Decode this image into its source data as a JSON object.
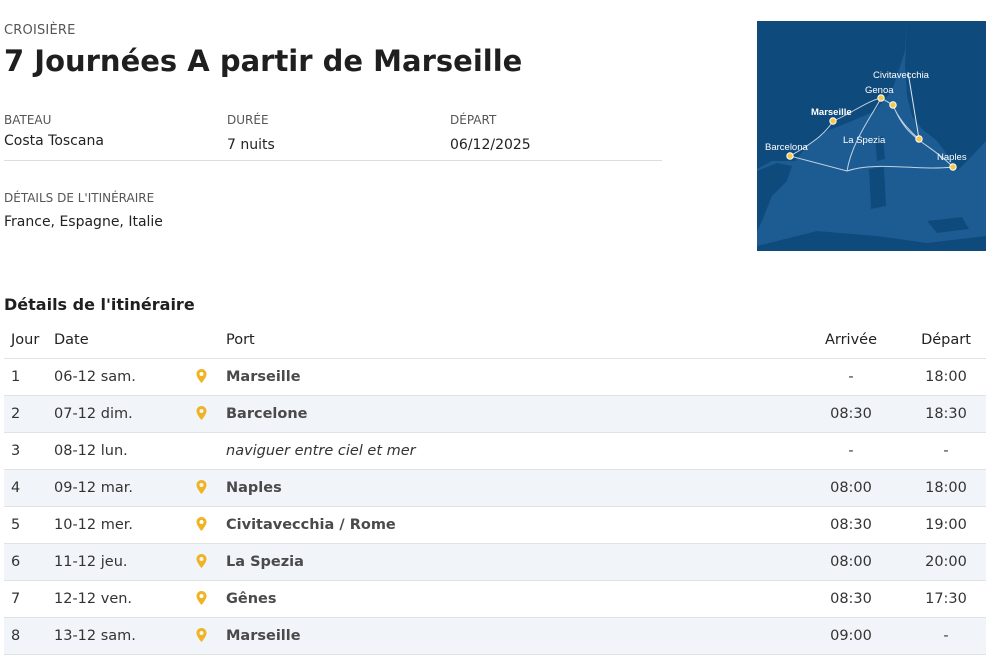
{
  "header": {
    "eyebrow": "CROISIÈRE",
    "title": "7 Journées A partir de Marseille"
  },
  "meta": {
    "ship_label": "BATEAU",
    "ship_value": "Costa Toscana",
    "duration_label": "DURÉE",
    "duration_value": "7 nuits",
    "departure_label": "DÉPART",
    "departure_value": "06/12/2025",
    "itinerary_label": "DÉTAILS DE L'ITINÉRAIRE",
    "itinerary_value": "France, Espagne, Italie"
  },
  "map": {
    "labels": {
      "civitavecchia": "Civitavecchia",
      "genoa": "Genoa",
      "marseille": "Marseille",
      "la_spezia": "La Spezia",
      "barcelona": "Barcelona",
      "naples": "Naples"
    },
    "colors": {
      "sea": "#1d5c93",
      "land": "#0f4a7d",
      "route": "#dbe7f2",
      "dot": "#f2c94c"
    }
  },
  "section": {
    "title": "Détails de l'itinéraire"
  },
  "table": {
    "headers": {
      "day": "Jour",
      "date": "Date",
      "port": "Port",
      "arrival": "Arrivée",
      "departure": "Départ"
    },
    "rows": [
      {
        "day": "1",
        "date": "06-12 sam.",
        "port": "Marseille",
        "arrival": "-",
        "departure": "18:00"
      },
      {
        "day": "2",
        "date": "07-12 dim.",
        "port": "Barcelone",
        "arrival": "08:30",
        "departure": "18:30"
      },
      {
        "day": "3",
        "date": "08-12 lun.",
        "port": "naviguer entre ciel et mer",
        "arrival": "-",
        "departure": "-"
      },
      {
        "day": "4",
        "date": "09-12 mar.",
        "port": "Naples",
        "arrival": "08:00",
        "departure": "18:00"
      },
      {
        "day": "5",
        "date": "10-12 mer.",
        "port": "Civitavecchia / Rome",
        "arrival": "08:30",
        "departure": "19:00"
      },
      {
        "day": "6",
        "date": "11-12 jeu.",
        "port": "La Spezia",
        "arrival": "08:00",
        "departure": "20:00"
      },
      {
        "day": "7",
        "date": "12-12 ven.",
        "port": "Gênes",
        "arrival": "08:30",
        "departure": "17:30"
      },
      {
        "day": "8",
        "date": "13-12 sam.",
        "port": "Marseille",
        "arrival": "09:00",
        "departure": "-"
      }
    ],
    "pin_color": "#f0b323"
  }
}
